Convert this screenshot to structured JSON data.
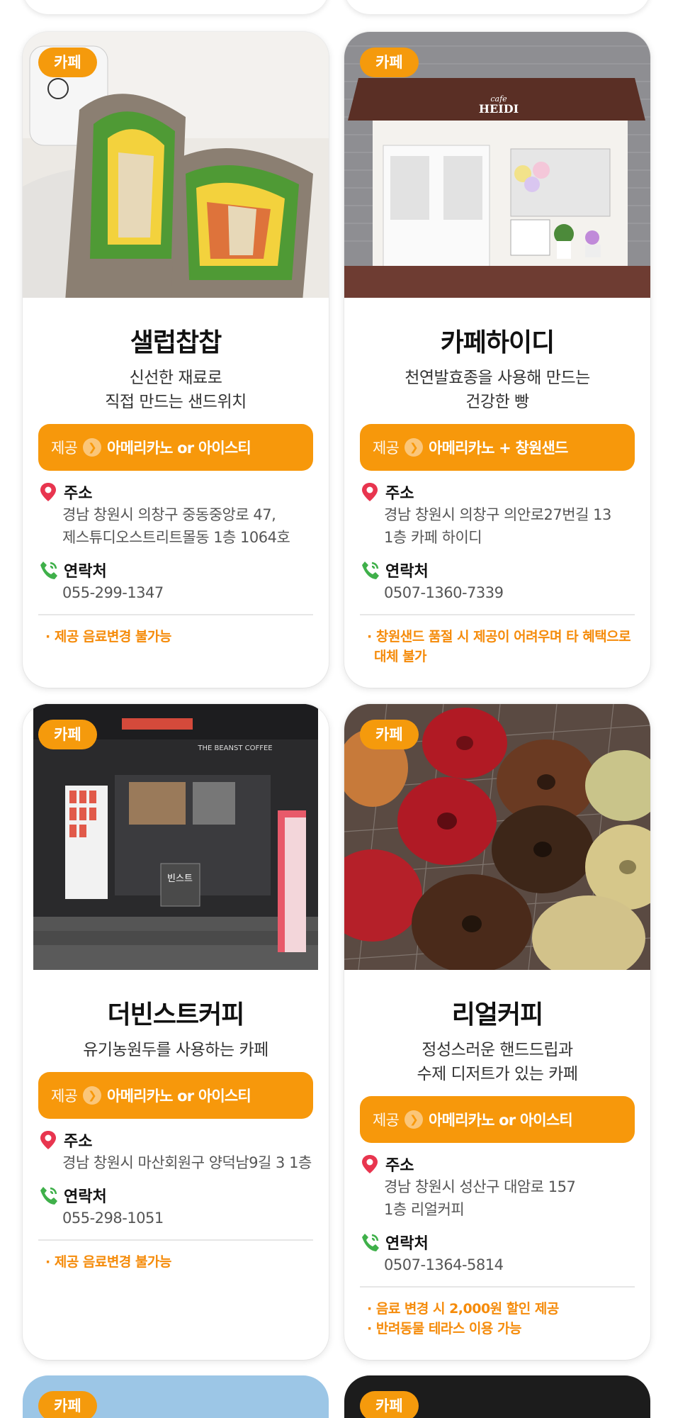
{
  "badge": "카페",
  "labels": {
    "offer": "제공",
    "address": "주소",
    "contact": "연락처"
  },
  "cards": [
    {
      "name": "샐럽찹찹",
      "desc": [
        "신선한 재료로",
        "직접 만드는 샌드위치"
      ],
      "offer": "아메리카노 or 아이스티",
      "address": [
        "경남 창원시 의창구 중동중앙로 47,",
        "제스튜디오스트리트몰동 1층 1064호"
      ],
      "phone": "055-299-1347",
      "notes": [
        "· 제공 음료변경 불가능"
      ]
    },
    {
      "name": "카페하이디",
      "desc": [
        "천연발효종을 사용해 만드는",
        "건강한 빵"
      ],
      "offer": "아메리카노 + 창원샌드",
      "address": [
        "경남 창원시 의창구 의안로27번길 13",
        "1층 카페 하이디"
      ],
      "phone": "0507-1360-7339",
      "notes": [
        "· 창원샌드 품절 시 제공이 어려우며 타 혜택으로 대체 불가"
      ],
      "photo_text": {
        "sign_small": "cafe",
        "sign": "HEIDI"
      }
    },
    {
      "name": "더빈스트커피",
      "desc": [
        "유기농원두를 사용하는 카페"
      ],
      "offer": "아메리카노 or 아이스티",
      "address": [
        "경남 창원시 마산회원구 양덕남9길 3 1층"
      ],
      "phone": "055-298-1051",
      "notes": [
        "· 제공 음료변경 불가능"
      ],
      "photo_text": {
        "sign": "THE BEANST COFFEE",
        "kiosk": "빈스트"
      }
    },
    {
      "name": "리얼커피",
      "desc": [
        "정성스러운 핸드드립과",
        "수제 디저트가 있는 카페"
      ],
      "offer": "아메리카노 or 아이스티",
      "address": [
        "경남 창원시 성산구 대암로 157",
        "1층 리얼커피"
      ],
      "phone": "0507-1364-5814",
      "notes": [
        "· 음료 변경 시 2,000원 할인 제공",
        "· 반려동물 테라스 이용 가능"
      ]
    }
  ],
  "colors": {
    "accent": "#f7980b",
    "pin": "#e8354f",
    "phone_icon": "#3fb04a"
  }
}
